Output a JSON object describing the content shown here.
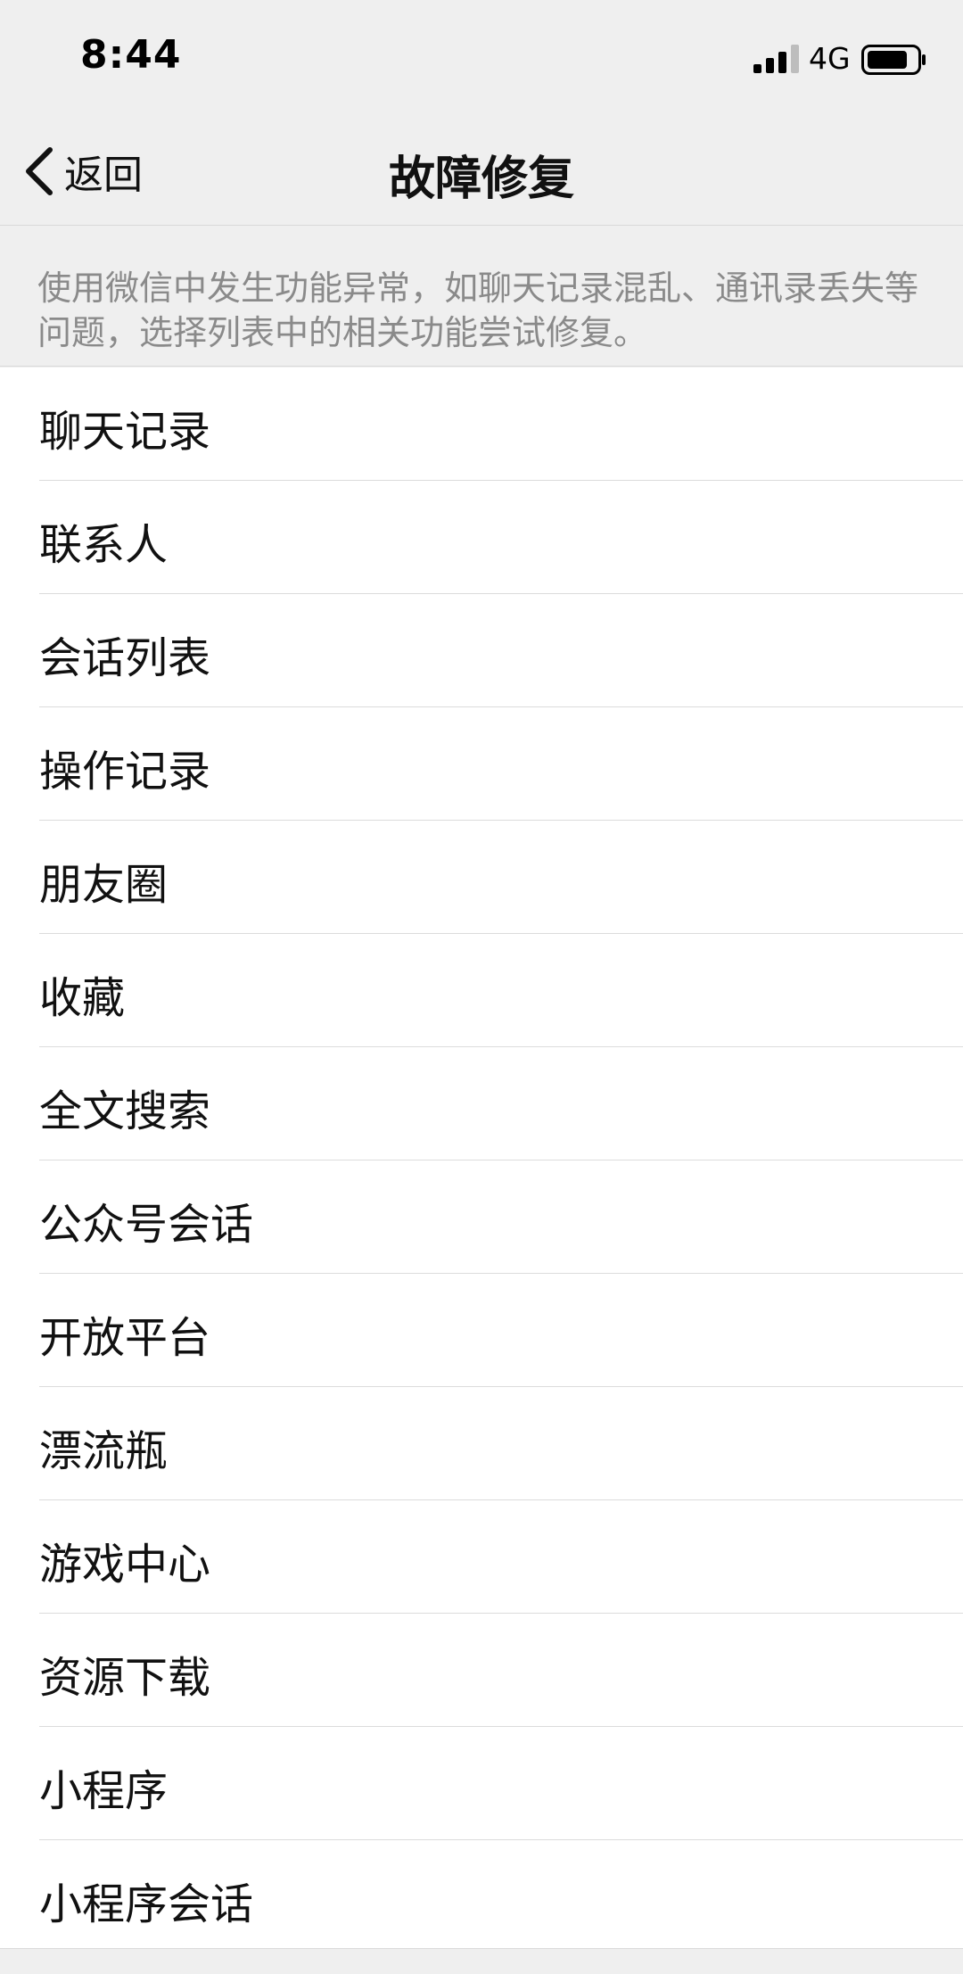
{
  "status_bar": {
    "time": "8:44",
    "network": "4G",
    "signal_icon": "cellular-signal-icon",
    "battery_icon": "battery-icon"
  },
  "nav": {
    "back_label": "返回",
    "back_icon": "chevron-left-icon",
    "title": "故障修复"
  },
  "description": "使用微信中发生功能异常，如聊天记录混乱、通讯录丢失等问题，选择列表中的相关功能尝试修复。",
  "items": [
    {
      "label": "聊天记录"
    },
    {
      "label": "联系人"
    },
    {
      "label": "会话列表"
    },
    {
      "label": "操作记录"
    },
    {
      "label": "朋友圈"
    },
    {
      "label": "收藏"
    },
    {
      "label": "全文搜索"
    },
    {
      "label": "公众号会话"
    },
    {
      "label": "开放平台"
    },
    {
      "label": "漂流瓶"
    },
    {
      "label": "游戏中心"
    },
    {
      "label": "资源下载"
    },
    {
      "label": "小程序"
    },
    {
      "label": "小程序会话"
    }
  ],
  "colors": {
    "background": "#efefef",
    "list_background": "#ffffff",
    "description_text": "#8a8a8a",
    "primary_text": "#111111"
  }
}
